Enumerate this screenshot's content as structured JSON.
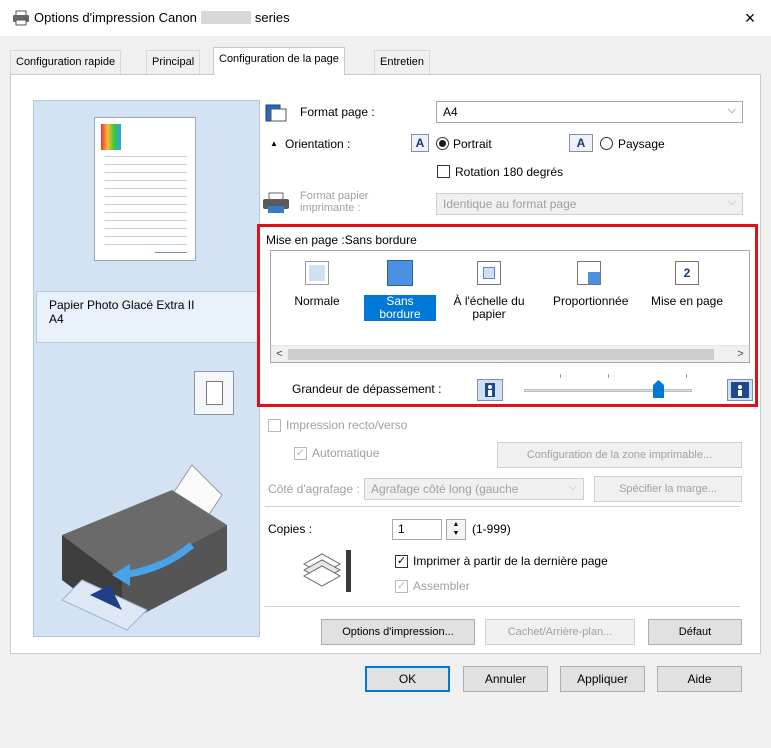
{
  "window": {
    "title_prefix": "Options d'impression Canon",
    "title_suffix": "series",
    "close": "×"
  },
  "tabs": [
    {
      "label": "Configuration rapide",
      "active": false
    },
    {
      "label": "Principal",
      "active": false
    },
    {
      "label": "Configuration de la page",
      "active": true
    },
    {
      "label": "Entretien",
      "active": false
    }
  ],
  "preview": {
    "media_line1": "Papier Photo Glacé Extra II",
    "media_line2": "A4"
  },
  "page_size": {
    "label": "Format page :",
    "value": "A4"
  },
  "orientation": {
    "label": "Orientation :",
    "portrait": "Portrait",
    "landscape": "Paysage",
    "selected": "Portrait",
    "icon_letter": "A"
  },
  "rotate": {
    "label": "Rotation 180 degrés",
    "checked": false
  },
  "printer_paper": {
    "label_line1": "Format papier",
    "label_line2": "imprimante :",
    "value": "Identique au format page"
  },
  "layout": {
    "label": "Mise en page :Sans bordure",
    "items": [
      {
        "label": "Normale",
        "selected": false
      },
      {
        "label": "Sans bordure",
        "selected": true
      },
      {
        "label_line1": "À l'échelle du",
        "label_line2": "papier",
        "selected": false
      },
      {
        "label": "Proportionnée",
        "selected": false
      },
      {
        "label": "Mise en page",
        "selected": false,
        "badge": "2"
      }
    ],
    "scroll_left": "<",
    "scroll_right": ">",
    "extension_label": "Grandeur de dépassement :",
    "extension_level": 0.8
  },
  "duplex": {
    "label": "Impression recto/verso",
    "auto_label": "Automatique",
    "area_button": "Configuration de la zone imprimable...",
    "staple_label": "Côté d'agrafage :",
    "staple_value": "Agrafage côté long (gauche",
    "margin_button": "Spécifier la marge..."
  },
  "copies": {
    "label": "Copies :",
    "value": "1",
    "range": "(1-999)",
    "reverse_label": "Imprimer à partir de la dernière page",
    "reverse_checked": true,
    "collate_label": "Assembler",
    "collate_checked": true
  },
  "buttons": {
    "print_options": "Options d'impression...",
    "stamp": "Cachet/Arrière-plan...",
    "defaults": "Défaut",
    "ok": "OK",
    "cancel": "Annuler",
    "apply": "Appliquer",
    "help": "Aide"
  },
  "colors": {
    "accent": "#0078d7",
    "highlight_frame": "#e0101a"
  }
}
